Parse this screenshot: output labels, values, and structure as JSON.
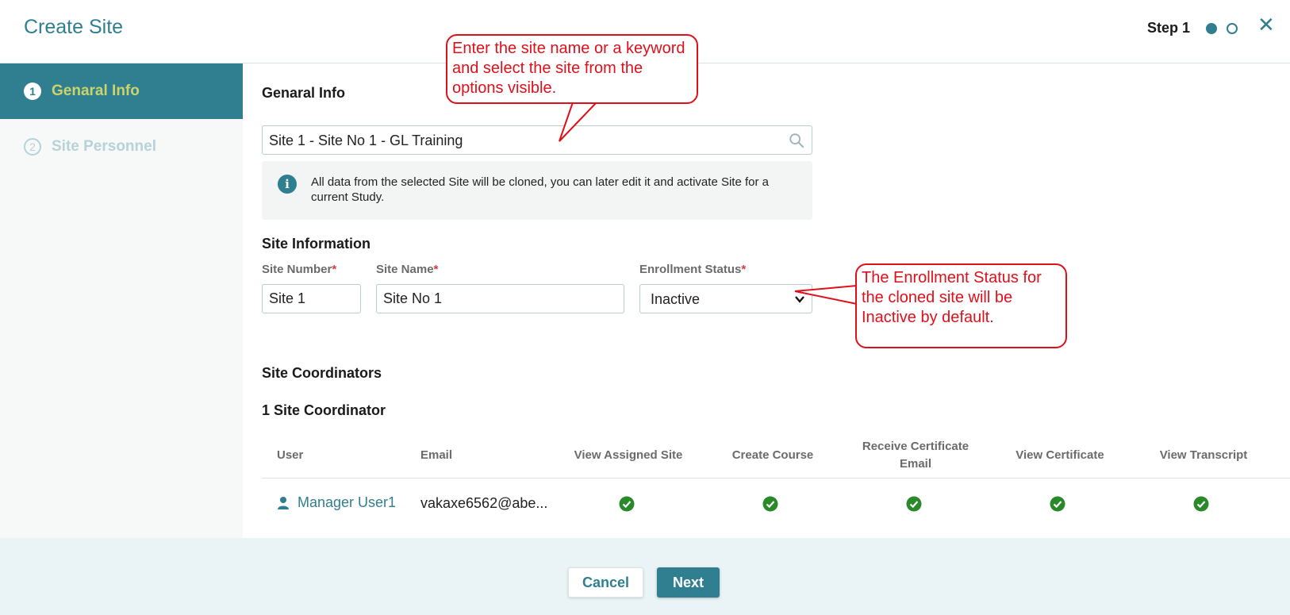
{
  "header": {
    "title": "Create Site",
    "step_label": "Step 1"
  },
  "sidebar": {
    "items": [
      {
        "number": "1",
        "label": "Genaral Info"
      },
      {
        "number": "2",
        "label": "Site Personnel"
      }
    ]
  },
  "general_info": {
    "section_title": "Genaral Info",
    "search_value": "Site 1 - Site No 1 - GL Training",
    "info_text": "All data from the selected Site will be cloned, you can later edit it and activate Site for a current Study."
  },
  "site_information": {
    "section_title": "Site Information",
    "site_number_label": "Site Number",
    "site_number_value": "Site 1",
    "site_name_label": "Site Name",
    "site_name_value": "Site No 1",
    "enrollment_status_label": "Enrollment Status",
    "enrollment_status_value": "Inactive",
    "required_marker": "*"
  },
  "site_coordinators": {
    "section_title": "Site Coordinators",
    "count_title": "1 Site Coordinator",
    "columns": [
      "User",
      "Email",
      "View Assigned Site",
      "Create Course",
      "Receive Certificate Email",
      "View Certificate",
      "View Transcript"
    ],
    "rows": [
      {
        "user": "Manager User1",
        "email": "vakaxe6562@abe...",
        "view_assigned_site": true,
        "create_course": true,
        "receive_certificate_email": true,
        "view_certificate": true,
        "view_transcript": true
      }
    ]
  },
  "footer": {
    "cancel_label": "Cancel",
    "next_label": "Next"
  },
  "callouts": {
    "search": "Enter the site name or a keyword and select the site from the options visible.",
    "enrollment": "The Enrollment Status for the cloned site will be Inactive by default."
  },
  "colors": {
    "accent": "#2f7f91",
    "active_label": "#cbd36b",
    "check": "#2a8a2a",
    "callout": "#e0101a"
  }
}
